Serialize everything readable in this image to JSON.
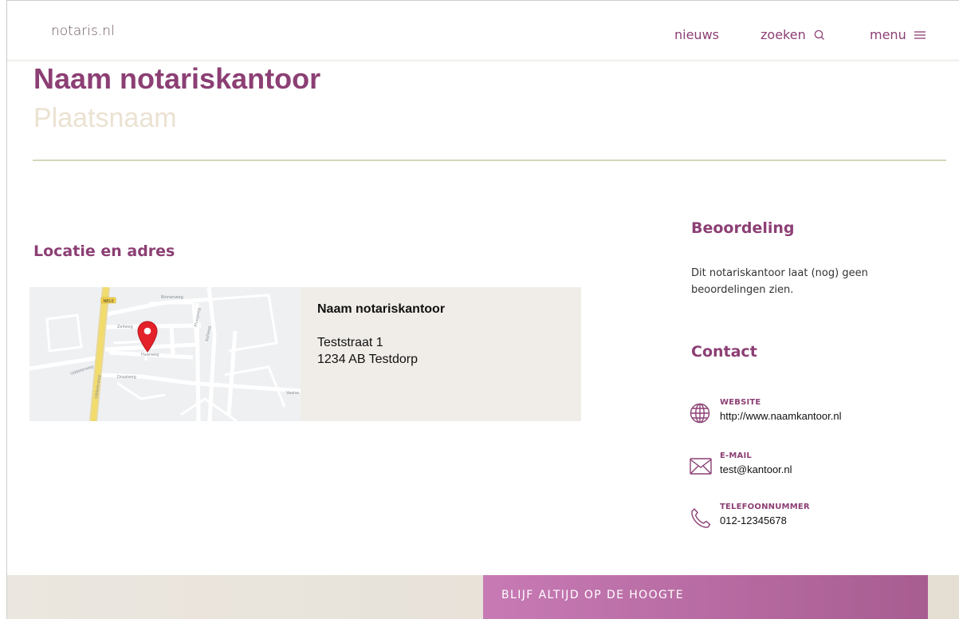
{
  "header": {
    "logo": "notaris.nl",
    "nav": {
      "news": "nieuws",
      "search": "zoeken",
      "menu": "menu"
    }
  },
  "office": {
    "name": "Naam notariskantoor",
    "city": "Plaatsnaam"
  },
  "location": {
    "heading": "Locatie en adres",
    "map_labels": {
      "road_badge": "N810",
      "street_1": "Binnenweg",
      "street_2": "Zeilweg",
      "street_3": "Haarweg",
      "street_4": "Uddelerweg",
      "street_5": "Zeilweg",
      "street_6": "Draaiweg",
      "street_7": "Vaalse",
      "street_8": "Pluegweg",
      "street_9": "Koliweg"
    },
    "card": {
      "name": "Naam notariskantoor",
      "street": "Teststraat 1",
      "postal_city": "1234 AB Testdorp"
    }
  },
  "review": {
    "heading": "Beoordeling",
    "text": "Dit notariskantoor laat (nog) geen beoordelingen zien."
  },
  "contact": {
    "heading": "Contact",
    "website": {
      "label": "WEBSITE",
      "value": "http://www.naamkantoor.nl",
      "icon": "globe-icon"
    },
    "email": {
      "label": "E-MAIL",
      "value": "test@kantoor.nl",
      "icon": "envelope-icon"
    },
    "phone": {
      "label": "TELEFOONNUMMER",
      "value": "012-12345678",
      "icon": "phone-icon"
    }
  },
  "footer": {
    "newsletter": "BLIJF ALTIJD OP DE HOOGTE"
  },
  "colors": {
    "brand_purple": "#8c3f74",
    "subtitle_beige": "#ebe2d2",
    "card_bg": "#f0ede8",
    "divider": "#d3d6bd"
  }
}
